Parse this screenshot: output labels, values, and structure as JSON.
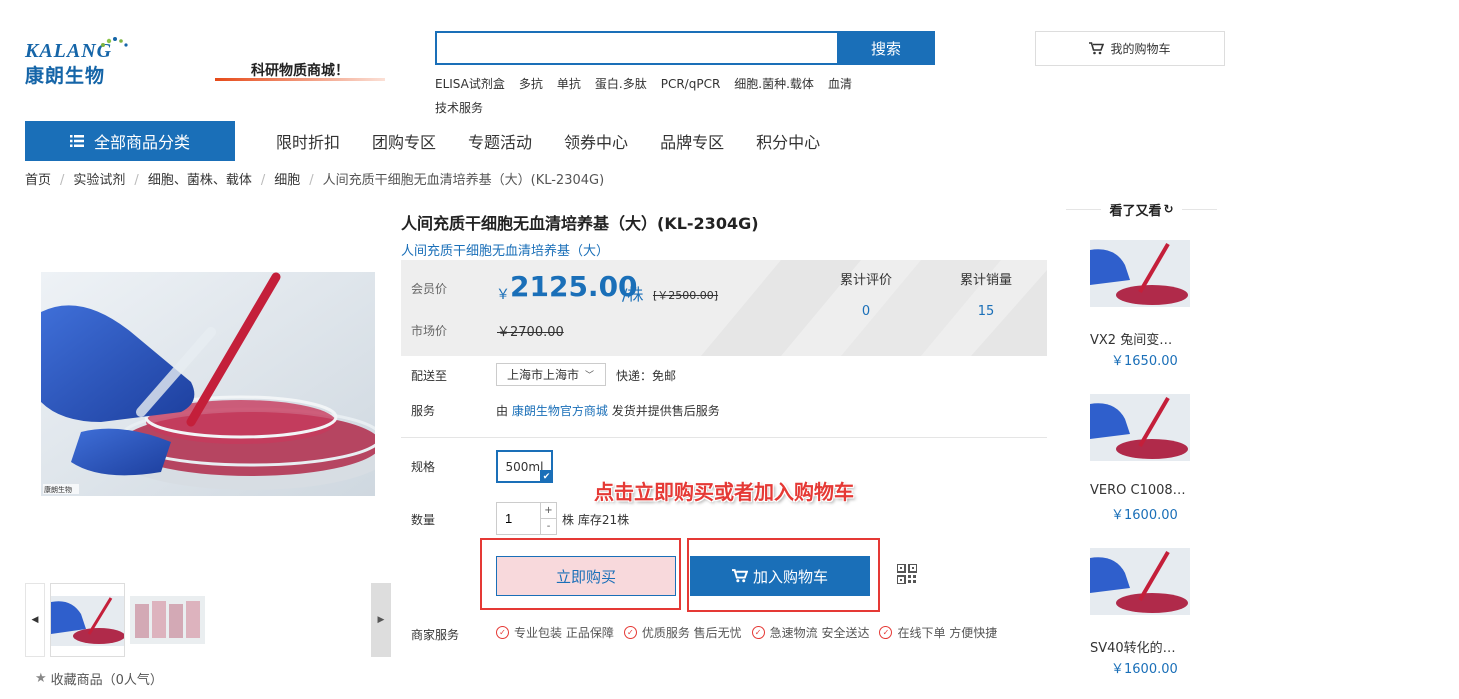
{
  "header": {
    "logo_en": "KALANG",
    "logo_cn": "康朗生物",
    "slogan": "科研物质商城！",
    "search_placeholder": "",
    "search_button": "搜索",
    "hotwords": [
      "ELISA试剂盒",
      "多抗",
      "单抗",
      "蛋白.多肽",
      "PCR/qPCR",
      "细胞.菌种.载体",
      "血清",
      "技术服务"
    ],
    "cart_label": "我的购物车"
  },
  "nav": {
    "category_button": "全部商品分类",
    "links": [
      "限时折扣",
      "团购专区",
      "专题活动",
      "领券中心",
      "品牌专区",
      "积分中心"
    ]
  },
  "breadcrumb": [
    "首页",
    "实验试剂",
    "细胞、菌株、载体",
    "细胞",
    "人间充质干细胞无血清培养基（大）(KL-2304G)"
  ],
  "product": {
    "title": "人间充质干细胞无血清培养基（大）(KL-2304G)",
    "subtitle": "人间充质干细胞无血清培养基（大）",
    "member_price_label": "会员价",
    "currency": "￥",
    "price": "2125.00",
    "unit": "/株",
    "orig_price": "[￥2500.00]",
    "market_price_label": "市场价",
    "market_price": "￥2700.00",
    "reviews_label": "累计评价",
    "reviews": "0",
    "sales_label": "累计销量",
    "sales": "15",
    "delivery_label": "配送至",
    "region": "上海市上海市",
    "shipping": "快递：免邮",
    "service_label": "服务",
    "service_prefix": "由",
    "service_shop": "康朗生物官方商城",
    "service_suffix": "发货并提供售后服务",
    "spec_label": "规格",
    "spec_value": "500ml",
    "qty_label": "数量",
    "qty_value": "1",
    "stock_text": "株 库存21株",
    "buy_now": "立即购买",
    "add_cart": "加入购物车",
    "merchant_label": "商家服务",
    "guarantees": [
      "专业包装 正品保障",
      "优质服务 售后无忧",
      "急速物流 安全送达",
      "在线下单 方便快捷"
    ],
    "favorite": "收藏商品（0人气）",
    "image_watermark": "康朗生物"
  },
  "annotation": "点击立即购买或者加入购物车",
  "sidebar": {
    "title": "看了又看",
    "items": [
      {
        "name": "VX2 兔间变…",
        "price": "￥1650.00"
      },
      {
        "name": "VERO C1008…",
        "price": "￥1600.00"
      },
      {
        "name": "SV40转化的…",
        "price": "￥1600.00"
      }
    ]
  },
  "colors": {
    "accent": "#1a6fb8",
    "annotation": "#e53935"
  }
}
